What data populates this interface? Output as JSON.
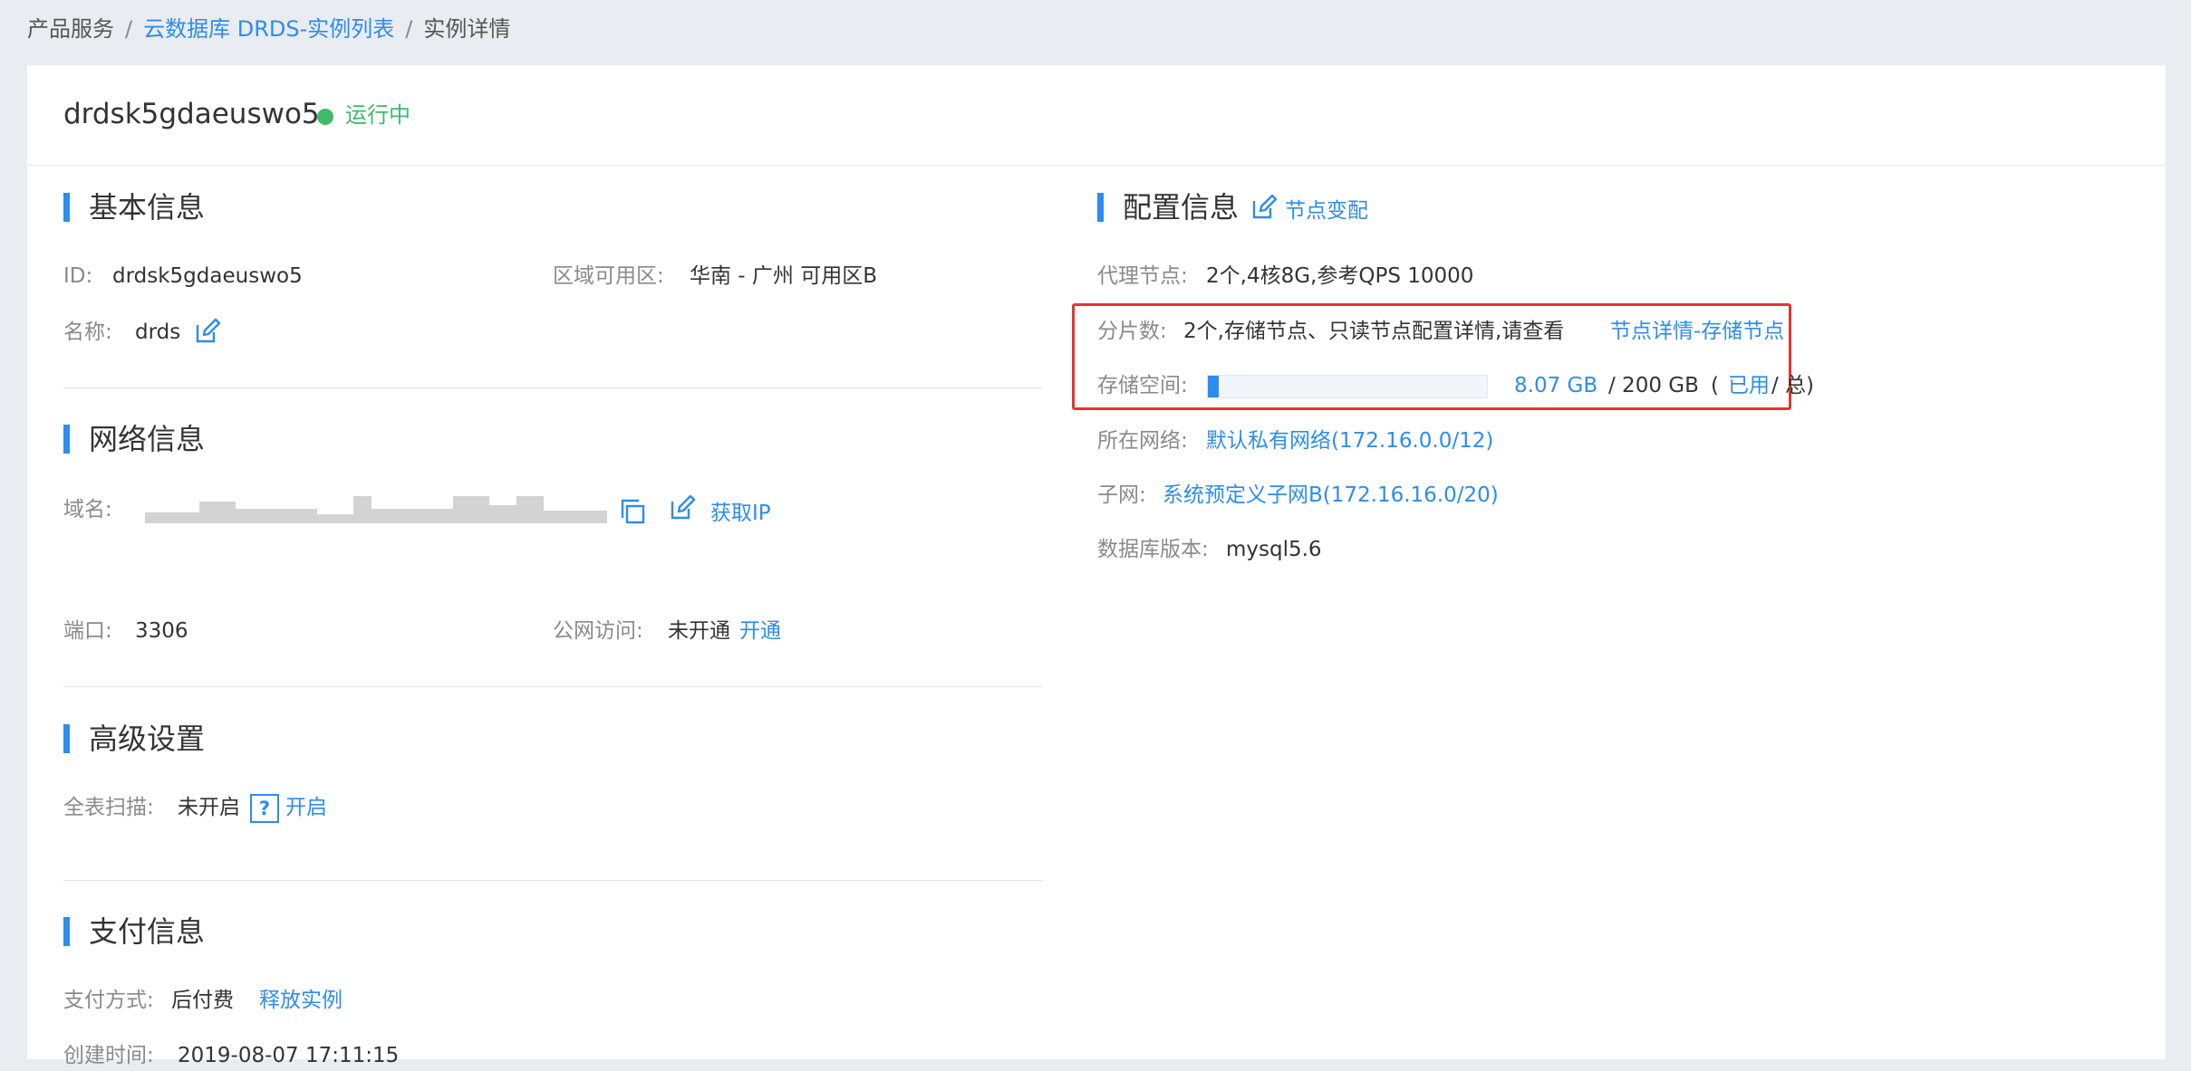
{
  "breadcrumb": {
    "root": "产品服务",
    "list": "云数据库 DRDS-实例列表",
    "current": "实例详情",
    "separator": "/"
  },
  "header": {
    "instance_name": "drdsk5gdaeuswo5",
    "status": "运行中"
  },
  "basic": {
    "title": "基本信息",
    "id_label": "ID:",
    "id_value": "drdsk5gdaeuswo5",
    "region_label": "区域可用区:",
    "region_value": "华南 - 广州 可用区B",
    "name_label": "名称:",
    "name_value": "drds"
  },
  "network": {
    "title": "网络信息",
    "domain_label": "域名:",
    "get_ip": "获取IP",
    "port_label": "端口:",
    "port_value": "3306",
    "public_label": "公网访问:",
    "public_value": "未开通",
    "public_action": "开通"
  },
  "advanced": {
    "title": "高级设置",
    "scan_label": "全表扫描:",
    "scan_value": "未开启",
    "help": "?",
    "scan_action": "开启"
  },
  "payment": {
    "title": "支付信息",
    "method_label": "支付方式:",
    "method_value": "后付费",
    "release": "释放实例",
    "created_label": "创建时间:",
    "created_value": "2019-08-07 17:11:15"
  },
  "config": {
    "title": "配置信息",
    "change_nodes": "节点变配",
    "proxy_label": "代理节点:",
    "proxy_value": "2个,4核8G,参考QPS 10000",
    "shard_label": "分片数:",
    "shard_value": "2个,存储节点、只读节点配置详情,请查看",
    "shard_link": "节点详情-存储节点",
    "storage_label": "存储空间:",
    "storage_used": "8.07 GB",
    "storage_total": "/ 200 GB",
    "storage_legend_open": "(",
    "storage_legend_used": "已用",
    "storage_legend_rest": "/ 总)",
    "storage_fraction": 0.04035,
    "network_label": "所在网络:",
    "network_value": "默认私有网络(172.16.0.0/12)",
    "subnet_label": "子网:",
    "subnet_value": "系统预定义子网B(172.16.16.0/20)",
    "db_version_label": "数据库版本:",
    "db_version_value": "mysql5.6"
  },
  "colors": {
    "accent": "#2d8cf0",
    "running": "#3ebc6b",
    "highlight": "#e5352f"
  }
}
